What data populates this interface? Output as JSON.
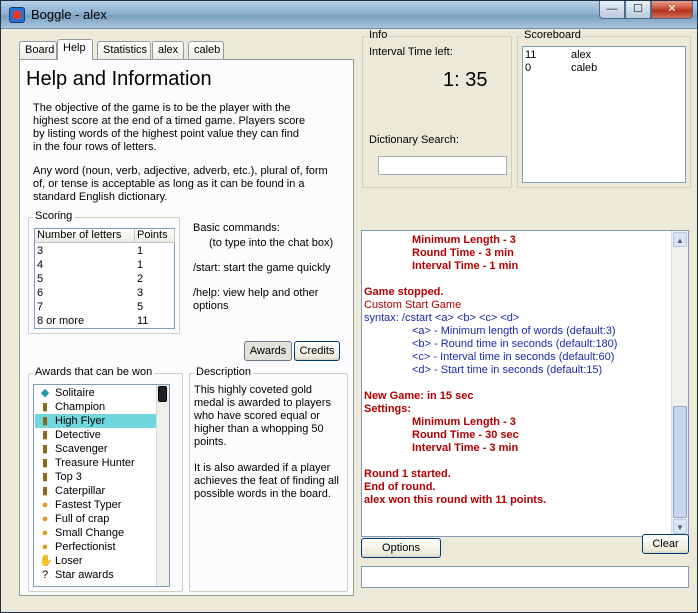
{
  "window": {
    "title": "Boggle - alex",
    "min_glyph": "—",
    "max_glyph": "☐",
    "close_glyph": "✕"
  },
  "tabs": [
    {
      "label": "Board",
      "active": false
    },
    {
      "label": "Help",
      "active": true
    },
    {
      "label": "Statistics",
      "active": false
    },
    {
      "label": "alex",
      "active": false
    },
    {
      "label": "caleb",
      "active": false
    }
  ],
  "help": {
    "title": "Help and Information",
    "para1": [
      "The objective of the game is to be the player with the",
      "highest score at the end of a timed game. Players score",
      "by listing words of the highest point value they can find",
      "in the four rows of letters."
    ],
    "para2": [
      "Any word (noun, verb, adjective, adverb, etc.), plural of, form",
      "of, or tense is acceptable as long as it can be found in a",
      "standard English dictionary."
    ]
  },
  "scoring": {
    "label": "Scoring",
    "headers": [
      "Number of letters",
      "Points"
    ],
    "rows": [
      [
        "3",
        "1"
      ],
      [
        "4",
        "1"
      ],
      [
        "5",
        "2"
      ],
      [
        "6",
        "3"
      ],
      [
        "7",
        "5"
      ],
      [
        "8 or more",
        "11"
      ]
    ]
  },
  "commands": {
    "title": "Basic commands:",
    "subtitle": "(to type into the chat box)",
    "start": "/start: start the game quickly",
    "help1": "/help: view help and other",
    "help2": "options"
  },
  "buttons": {
    "awards": "Awards",
    "credits": "Credits",
    "options": "Options",
    "clear": "Clear"
  },
  "awards": {
    "label": "Awards that can be won",
    "items": [
      {
        "name": "Solitaire",
        "icon": "diamond-icon",
        "glyph": "◆",
        "color": "#1a9aa8"
      },
      {
        "name": "Champion",
        "icon": "medal-icon",
        "glyph": "▮",
        "color": "#8a6a1f"
      },
      {
        "name": "High Flyer",
        "icon": "medal-icon",
        "glyph": "▮",
        "color": "#8a6a1f",
        "selected": true
      },
      {
        "name": "Detective",
        "icon": "medal-icon",
        "glyph": "▮",
        "color": "#8a6a1f"
      },
      {
        "name": "Scavenger",
        "icon": "medal-icon",
        "glyph": "▮",
        "color": "#8a6a1f"
      },
      {
        "name": "Treasure Hunter",
        "icon": "medal-icon",
        "glyph": "▮",
        "color": "#8a6a1f"
      },
      {
        "name": "Top 3",
        "icon": "medal-icon",
        "glyph": "▮",
        "color": "#8a6a1f"
      },
      {
        "name": "Caterpillar",
        "icon": "medal-icon",
        "glyph": "▮",
        "color": "#8a6a1f"
      },
      {
        "name": "Fastest Typer",
        "icon": "coin-icon",
        "glyph": "●",
        "color": "#e09a1a"
      },
      {
        "name": "Full of crap",
        "icon": "coin-icon",
        "glyph": "●",
        "color": "#e09a1a"
      },
      {
        "name": "Small Change",
        "icon": "coin-icon",
        "glyph": "●",
        "color": "#e09a1a"
      },
      {
        "name": "Perfectionist",
        "icon": "coin-icon",
        "glyph": "●",
        "color": "#e09a1a"
      },
      {
        "name": "Loser",
        "icon": "hand-icon",
        "glyph": "✋",
        "color": "#d28a1a"
      },
      {
        "name": "Star awards",
        "icon": "question-icon",
        "glyph": "?",
        "color": "#000000"
      }
    ]
  },
  "description": {
    "label": "Description",
    "para1": [
      "This highly coveted gold",
      "medal is awarded to players",
      "who have scored equal or",
      "higher than a whopping 50",
      "points."
    ],
    "para2": [
      "It is also awarded if a player",
      "achieves the feat of finding all",
      "possible words in the board."
    ]
  },
  "info": {
    "label": "Info",
    "interval_label": "Interval Time left:",
    "time": "1: 35",
    "dict_label": "Dictionary Search:",
    "dict_value": ""
  },
  "scoreboard": {
    "label": "Scoreboard",
    "rows": [
      {
        "score": "11",
        "name": "alex"
      },
      {
        "score": "0",
        "name": "caleb"
      }
    ]
  },
  "chat": [
    {
      "text": "Minimum Length - 3",
      "style": "red-b",
      "indent": 48
    },
    {
      "text": "Round Time - 3 min",
      "style": "red-b",
      "indent": 48
    },
    {
      "text": "Interval Time - 1 min",
      "style": "red-b",
      "indent": 48
    },
    {
      "text": "",
      "style": "red",
      "indent": 0
    },
    {
      "text": "Game stopped.",
      "style": "red-b",
      "indent": 0
    },
    {
      "text": "Custom Start Game",
      "style": "red",
      "indent": 0
    },
    {
      "text": "syntax: /cstart <a> <b> <c> <d>",
      "style": "blue",
      "indent": 0
    },
    {
      "text": "<a> - Minimum length of words (default:3)",
      "style": "blue",
      "indent": 48
    },
    {
      "text": "<b> - Round time in seconds (default:180)",
      "style": "blue",
      "indent": 48
    },
    {
      "text": "<c> - Interval time in seconds (default:60)",
      "style": "blue",
      "indent": 48
    },
    {
      "text": "<d> - Start time in seconds (default:15)",
      "style": "blue",
      "indent": 48
    },
    {
      "text": "",
      "style": "red",
      "indent": 0
    },
    {
      "text": "New Game: in 15 sec",
      "style": "red-b",
      "indent": 0
    },
    {
      "text": "Settings:",
      "style": "red-b",
      "indent": 0
    },
    {
      "text": "Minimum Length - 3",
      "style": "red-b",
      "indent": 48
    },
    {
      "text": "Round Time - 30 sec",
      "style": "red-b",
      "indent": 48
    },
    {
      "text": "Interval Time - 3 min",
      "style": "red-b",
      "indent": 48
    },
    {
      "text": "",
      "style": "red",
      "indent": 0
    },
    {
      "text": "Round 1 started.",
      "style": "red-b",
      "indent": 0
    },
    {
      "text": "End of round.",
      "style": "red-b",
      "indent": 0
    },
    {
      "text": "alex won this round with 11 points.",
      "style": "red-b",
      "indent": 0
    }
  ],
  "chat_input": {
    "value": ""
  },
  "scroll_glyphs": {
    "up": "▲",
    "down": "▼"
  }
}
